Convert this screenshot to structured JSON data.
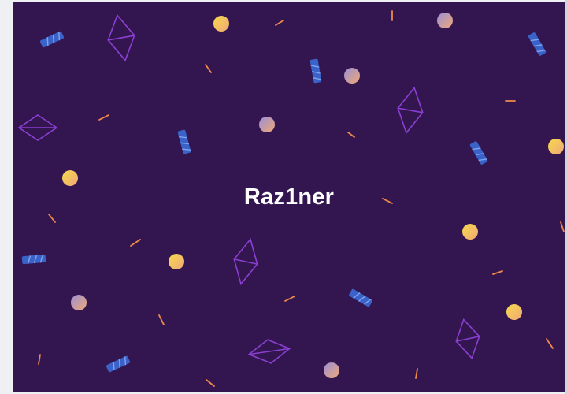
{
  "banner": {
    "title": "Raz1ner",
    "colors": {
      "background": "#331650",
      "diamond_outline": "#8a3fd0",
      "capsule": "#3a62c8",
      "capsule_stripe": "#7fa3ec",
      "dot_yellow": "#f7d94c",
      "dot_peach": "#f0a877",
      "dot_blue_tint": "#9a8fd6",
      "dash": "#f08a4b"
    },
    "decorations": [
      "diamond-outline",
      "striped-capsule",
      "gradient-dot",
      "confetti-dash"
    ]
  }
}
